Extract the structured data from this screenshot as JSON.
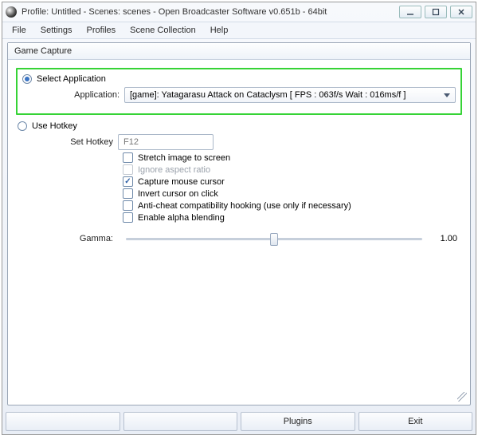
{
  "window": {
    "title": "Profile: Untitled - Scenes: scenes - Open Broadcaster Software v0.651b - 64bit"
  },
  "menu": {
    "file": "File",
    "settings": "Settings",
    "profiles": "Profiles",
    "scene_collection": "Scene Collection",
    "help": "Help"
  },
  "dialog": {
    "title": "Game Capture",
    "select_application": "Select Application",
    "application_label": "Application:",
    "application_value": "[game]: Yatagarasu Attack on Cataclysm [ FPS : 063f/s Wait : 016ms/f ]",
    "use_hotkey": "Use Hotkey",
    "set_hotkey_label": "Set Hotkey",
    "set_hotkey_value": "F12",
    "stretch": "Stretch image to screen",
    "ignore_aspect": "Ignore aspect ratio",
    "capture_cursor": "Capture mouse cursor",
    "invert_cursor": "Invert cursor on click",
    "anticheat": "Anti-cheat compatibility hooking (use only if necessary)",
    "alpha": "Enable alpha blending",
    "gamma_label": "Gamma:",
    "gamma_value": "1.00"
  },
  "bottom": {
    "plugins": "Plugins",
    "exit": "Exit"
  }
}
